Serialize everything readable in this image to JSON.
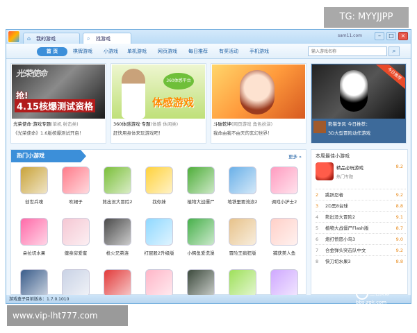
{
  "watermarks": {
    "top": "TG: MYYJJPP",
    "bottom": "www.vip-lht777.com",
    "logo_text": "三石资源 bbs.zgk.com"
  },
  "window": {
    "tabs": [
      {
        "label": "我的游戏",
        "icon": "home-icon"
      },
      {
        "label": "找游戏",
        "icon": "search-icon"
      }
    ],
    "user": "sam11.com",
    "buttons": {
      "min": "–",
      "max": "□",
      "close": "×"
    }
  },
  "nav": {
    "items": [
      "首 页",
      "棋牌游戏",
      "小游戏",
      "单机游戏",
      "网页游戏",
      "每日推荐",
      "有奖活动",
      "手机游戏"
    ],
    "search_placeholder": "输入游戏名称"
  },
  "banners": [
    {
      "art_logo": "光荣使命",
      "art_big": "4.15核爆测试资格",
      "art_small": "抢!",
      "title": "光荣使命·游戏专题",
      "tag": "(单机 射击类)",
      "desc": "《光荣使命》1.6版核爆测试开启！"
    },
    {
      "art_big": "体感游戏",
      "art_small": "360体感平台",
      "title": "360体感游戏·专题",
      "tag": "(体感 休闲类)",
      "desc": "赶快用身体来玩游戏吧！"
    },
    {
      "title": "斗破乾坤",
      "tag": "(网页游戏 角色扮演)",
      "desc": "我命由我不由天的玄幻世界！"
    },
    {
      "ribbon": "今日推荐",
      "title": "熊猫争风 今日推荐：",
      "desc": "3D大型冒险动作游戏"
    }
  ],
  "hot": {
    "title": "热门小游戏",
    "more": "更多 »",
    "games": [
      "创世兵魂",
      "吹裙子",
      "熊出没大冒险2",
      "找你妹",
      "植物大战僵尸",
      "地铁里要流浪2",
      "调戏小护士2",
      "朵拉切水果",
      "健身房爱蜜",
      "枪火兄弟连",
      "打屁股2升级版",
      "小鳄鱼爱洗澡",
      "冒险王疯狂版",
      "捕获美人鱼",
      "",
      "",
      "",
      "",
      "",
      "",
      ""
    ]
  },
  "side": {
    "title": "本周最佳小游戏",
    "top": {
      "name": "精品必玩游戏",
      "sub": "热门专题",
      "score": "8.2"
    },
    "ranks": [
      {
        "no": "2",
        "name": "跳跃忍者",
        "score": "9.2"
      },
      {
        "no": "3",
        "name": "2D黑8台球",
        "score": "8.8"
      },
      {
        "no": "4",
        "name": "熊出没大冒险2",
        "score": "9.1"
      },
      {
        "no": "5",
        "name": "植物大战僵尸Flash版",
        "score": "8.7"
      },
      {
        "no": "6",
        "name": "炮打愤怒小鸟3",
        "score": "9.0"
      },
      {
        "no": "7",
        "name": "合金弹头突击队中文",
        "score": "9.2"
      },
      {
        "no": "8",
        "name": "快刀切水果3",
        "score": "8.8"
      }
    ]
  },
  "status": "游戏盒子目前版本：1.7.0.1010"
}
